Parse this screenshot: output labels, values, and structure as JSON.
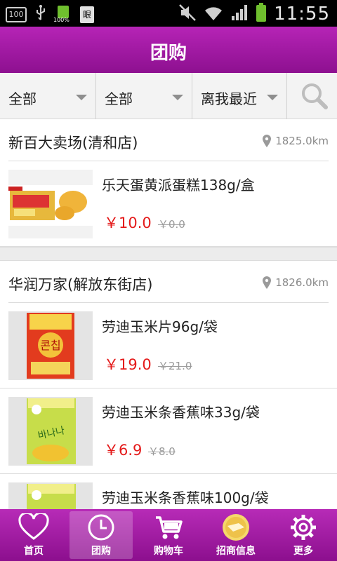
{
  "status_bar": {
    "box_label": "100",
    "battery_small_label": "100%",
    "doc_label": "眼",
    "time": "11:55"
  },
  "header": {
    "title": "团购"
  },
  "filters": {
    "category": "全部",
    "area": "全部",
    "sort": "离我最近"
  },
  "stores": [
    {
      "name": "新百大卖场(清和店)",
      "distance": "1825.0km",
      "products": [
        {
          "name": "乐天蛋黄派蛋糕138g/盒",
          "price": "￥10.0",
          "old_price": "￥0.0"
        }
      ]
    },
    {
      "name": "华润万家(解放东街店)",
      "distance": "1826.0km",
      "products": [
        {
          "name": "劳迪玉米片96g/袋",
          "price": "￥19.0",
          "old_price": "￥21.0"
        },
        {
          "name": "劳迪玉米条香蕉味33g/袋",
          "price": "￥6.9",
          "old_price": "￥8.0"
        },
        {
          "name": "劳迪玉米条香蕉味100g/袋",
          "price": "",
          "old_price": ""
        }
      ]
    }
  ],
  "bottom_nav": {
    "tabs": [
      {
        "label": "首页",
        "icon": "heart-icon"
      },
      {
        "label": "团购",
        "icon": "clock-icon"
      },
      {
        "label": "购物车",
        "icon": "cart-icon"
      },
      {
        "label": "招商信息",
        "icon": "merchant-badge-icon"
      },
      {
        "label": "更多",
        "icon": "gear-icon"
      }
    ],
    "active_index": 1
  },
  "colors": {
    "brand": "#a21fa5",
    "price": "#e41a1a"
  }
}
